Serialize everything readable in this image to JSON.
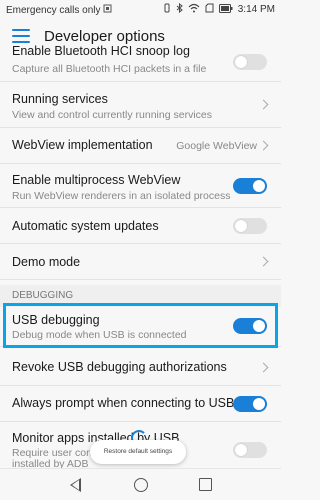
{
  "status_bar": {
    "carrier_text": "Emergency calls only",
    "time": "3:14 PM"
  },
  "app_bar": {
    "title": "Developer options"
  },
  "rows": [
    {
      "title": "Enable Bluetooth HCI snoop log",
      "subtitle": "Capture all Bluetooth HCI packets in a file",
      "control": "toggle",
      "on": false
    },
    {
      "title": "Running services",
      "subtitle": "View and control currently running services",
      "control": "chevron"
    },
    {
      "title": "WebView implementation",
      "value": "Google WebView",
      "control": "chevron"
    },
    {
      "title": "Enable multiprocess WebView",
      "subtitle": "Run WebView renderers in an isolated process",
      "control": "toggle",
      "on": true
    },
    {
      "title": "Automatic system updates",
      "control": "toggle",
      "on": false
    },
    {
      "title": "Demo mode",
      "control": "chevron"
    }
  ],
  "section": {
    "debugging": "DEBUGGING"
  },
  "debug_rows": [
    {
      "title": "USB debugging",
      "subtitle": "Debug mode when USB is connected",
      "control": "toggle",
      "on": true
    },
    {
      "title": "Revoke USB debugging authorizations",
      "control": "chevron"
    },
    {
      "title": "Always prompt when connecting to USB",
      "control": "toggle",
      "on": true
    },
    {
      "title": "Monitor apps installed by USB",
      "subtitle_line1": "Require user confirmation for apps",
      "subtitle_line2": "installed by ADB",
      "control": "toggle",
      "on": false
    }
  ],
  "toast": {
    "text": "Restore default settings"
  },
  "colors": {
    "accent": "#1a7fd6",
    "highlight_border": "#0aa5e6"
  }
}
